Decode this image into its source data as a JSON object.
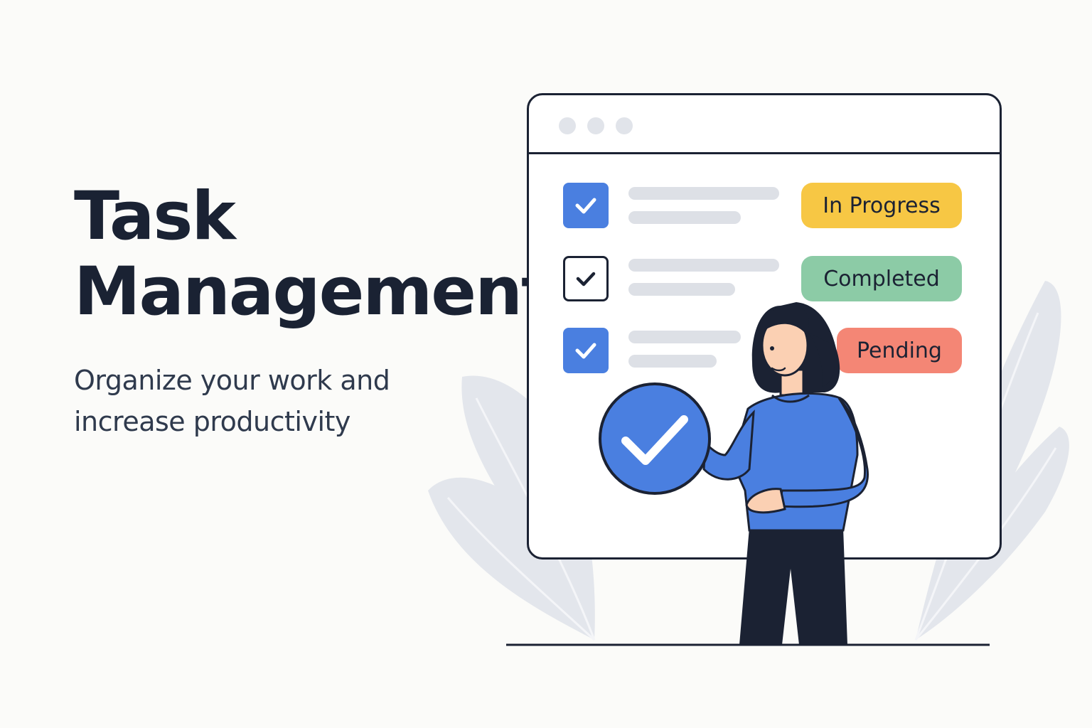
{
  "headline": {
    "line1": "Task",
    "line2": "Management"
  },
  "subtitle": {
    "line1": "Organize your work and",
    "line2": "increase productivity"
  },
  "tasks": [
    {
      "checked": true,
      "checkbox_style": "filled",
      "status": "In Progress",
      "status_color": "#f7c744"
    },
    {
      "checked": true,
      "checkbox_style": "outline",
      "status": "Completed",
      "status_color": "#8ccba6"
    },
    {
      "checked": true,
      "checkbox_style": "filled",
      "status": "Pending",
      "status_color": "#f48675"
    }
  ],
  "colors": {
    "background": "#fbfbf9",
    "primary": "#4a7fe0",
    "ink": "#1b2233",
    "leaf": "#e3e6ec",
    "placeholder": "#dde0e6"
  },
  "icons": [
    "check-icon",
    "big-check-badge-icon",
    "window-dot-icon",
    "leaf-icon",
    "person-illustration"
  ]
}
